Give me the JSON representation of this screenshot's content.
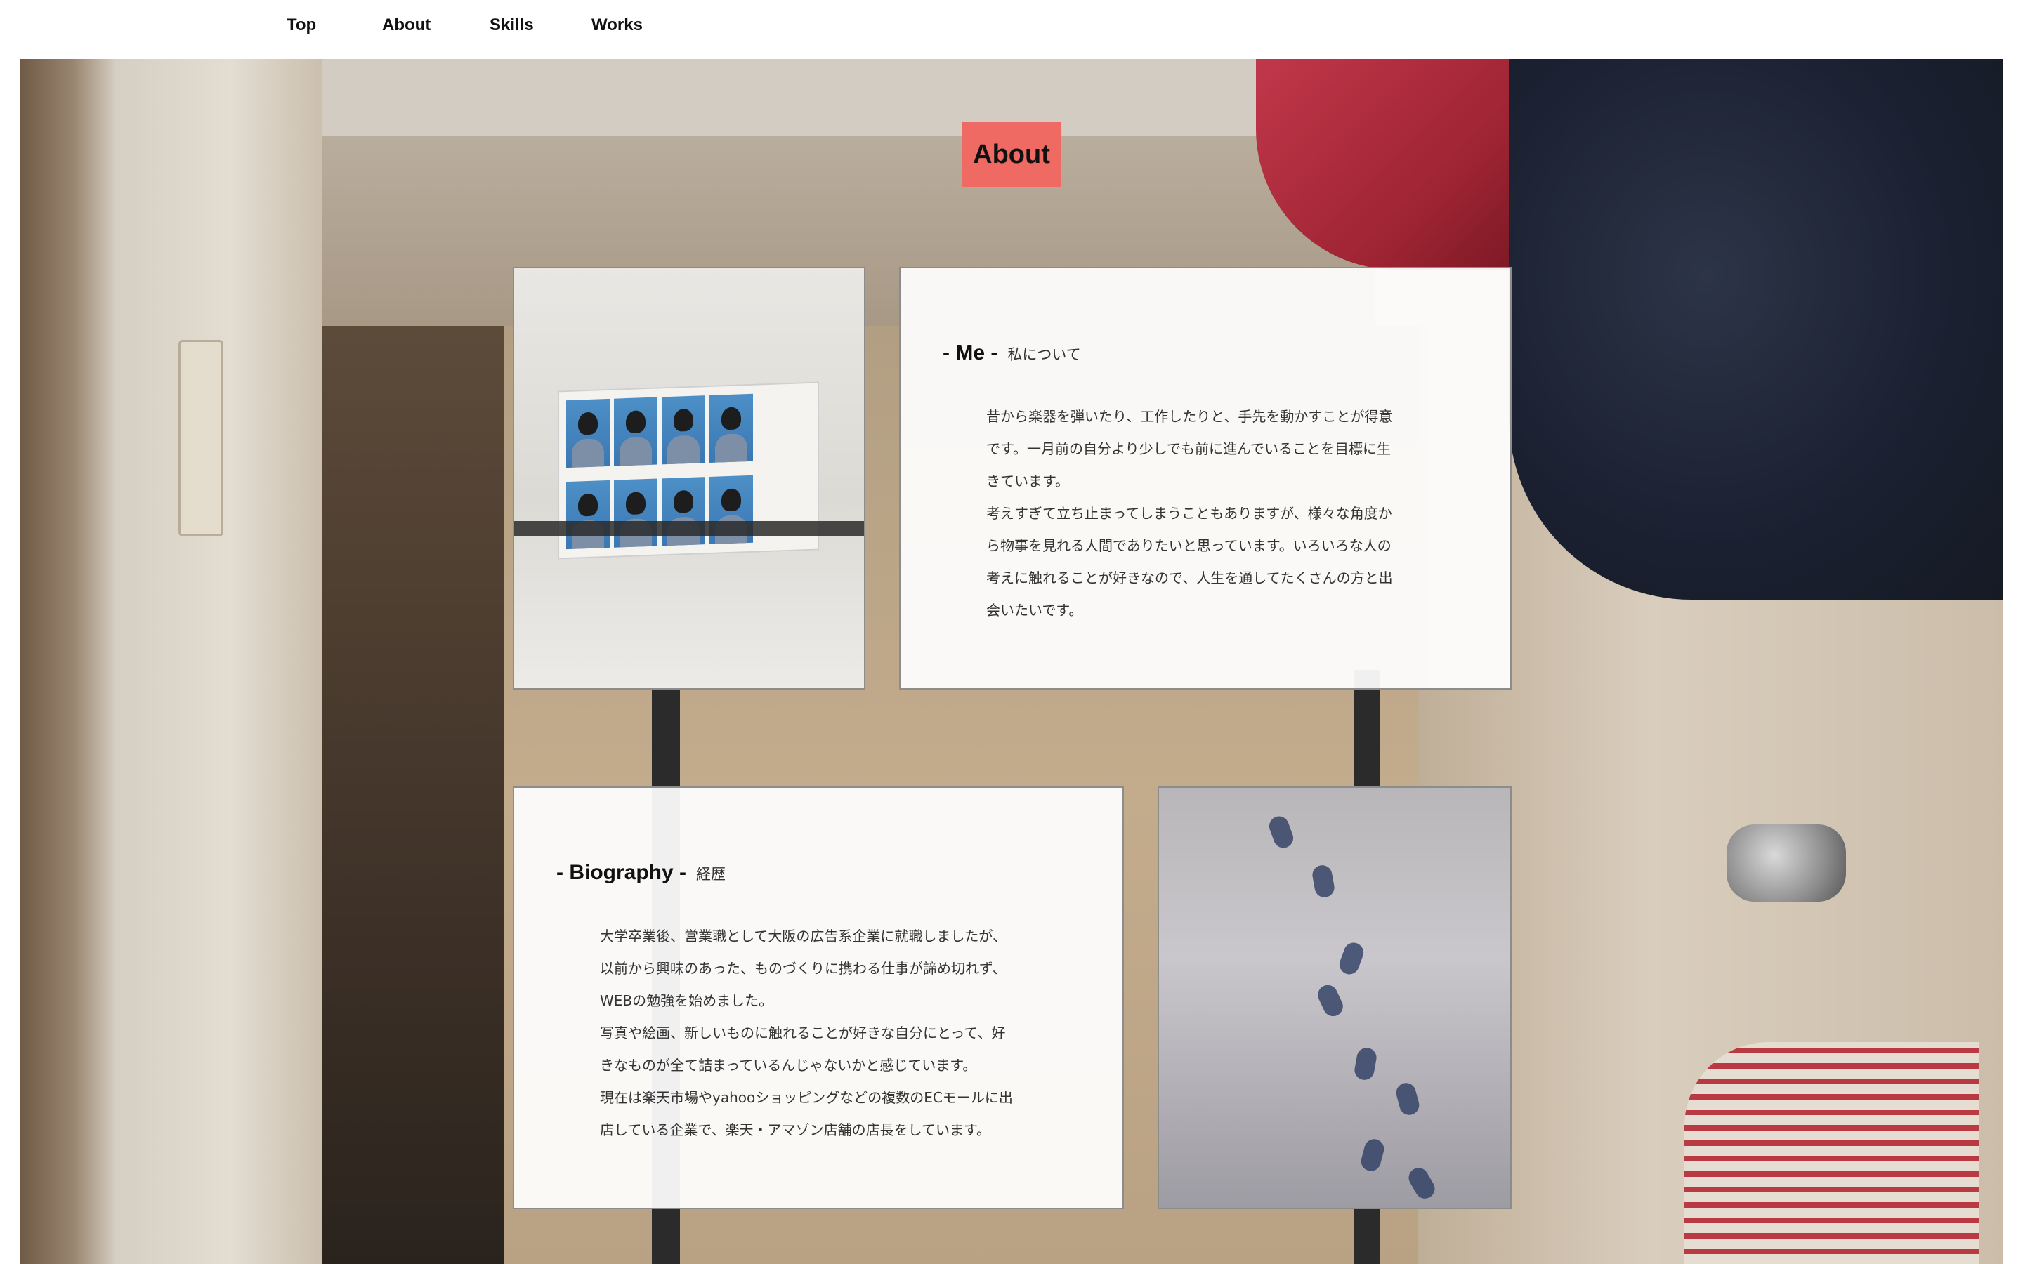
{
  "nav": {
    "items": [
      {
        "label": "Top"
      },
      {
        "label": "About"
      },
      {
        "label": "Skills"
      },
      {
        "label": "Works"
      }
    ]
  },
  "section": {
    "title": "About"
  },
  "me": {
    "heading": "- Me -",
    "subheading": "私について",
    "paragraphs": [
      "昔から楽器を弾いたり、工作したりと、手先を動かすことが得意",
      "です。一月前の自分より少しでも前に進んでいることを目標に生",
      "きています。",
      "考えすぎて立ち止まってしまうこともありますが、様々な角度か",
      "ら物事を見れる人間でありたいと思っています。いろいろな人の",
      "考えに触れることが好きなので、人生を通してたくさんの方と出",
      "会いたいです。"
    ],
    "photo_icon": "id-photo-image"
  },
  "biography": {
    "heading": "- Biography -",
    "subheading": "経歴",
    "paragraphs": [
      "大学卒業後、営業職として大阪の広告系企業に就職しましたが、",
      "以前から興味のあった、ものづくりに携わる仕事が諦め切れず、",
      "WEBの勉強を始めました。",
      "写真や絵画、新しいものに触れることが好きな自分にとって、好",
      "きなものが全て詰まっているんじゃないかと感じています。",
      "現在は楽天市場やyahooショッピングなどの複数のECモールに出",
      "店している企業で、楽天・アマゾン店舗の店長をしています。"
    ],
    "photo_icon": "snow-footprints-image"
  },
  "colors": {
    "accent": "#ef6a63",
    "card_bg": "#ffffff",
    "text": "#333333"
  }
}
